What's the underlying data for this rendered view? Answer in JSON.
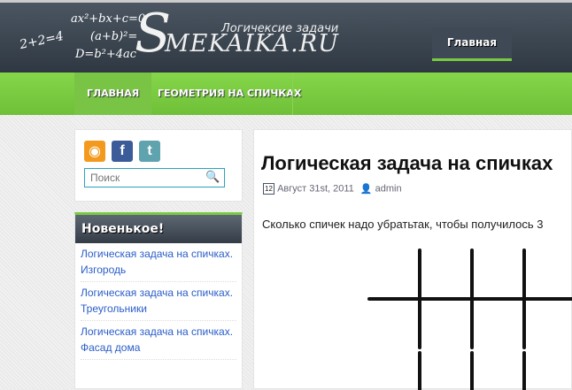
{
  "header": {
    "formulas": [
      "2+2=4",
      "ax²+bx+c=0",
      "(a+b)²=",
      "D=b²+4ac"
    ],
    "logo_s": "S",
    "logo_rest": "MEKAIKA.RU",
    "tagline": "Логичексие задачи",
    "top_nav": {
      "home": "Главная"
    }
  },
  "nav": {
    "items": [
      {
        "label": "ГЛАВНАЯ",
        "active": true
      },
      {
        "label": "ГЕОМЕТРИЯ НА СПИЧКАХ",
        "active": false
      }
    ]
  },
  "sidebar": {
    "social": [
      "rss-icon",
      "facebook-icon",
      "twitter-icon"
    ],
    "search_placeholder": "Поиск",
    "recent_title": "Новенькое!",
    "recent": [
      {
        "line1": "Логическая задача на спичках.",
        "line2": "Изгородь"
      },
      {
        "line1": "Логическая задача на спичках.",
        "line2": "Треугольники"
      },
      {
        "line1": "Логическая задача на спичках.",
        "line2": "Фасад дома"
      }
    ]
  },
  "post": {
    "title": "Логическая задача на спичках",
    "date": "Август 31st, 2011",
    "author": "admin",
    "text": "Сколько спичек надо убратьтак, чтобы получилось 3"
  },
  "colors": {
    "accent_green": "#7ac943",
    "header_dark": "#3a434e",
    "link": "#2a5dc8",
    "search_border": "#2aa3c0"
  }
}
